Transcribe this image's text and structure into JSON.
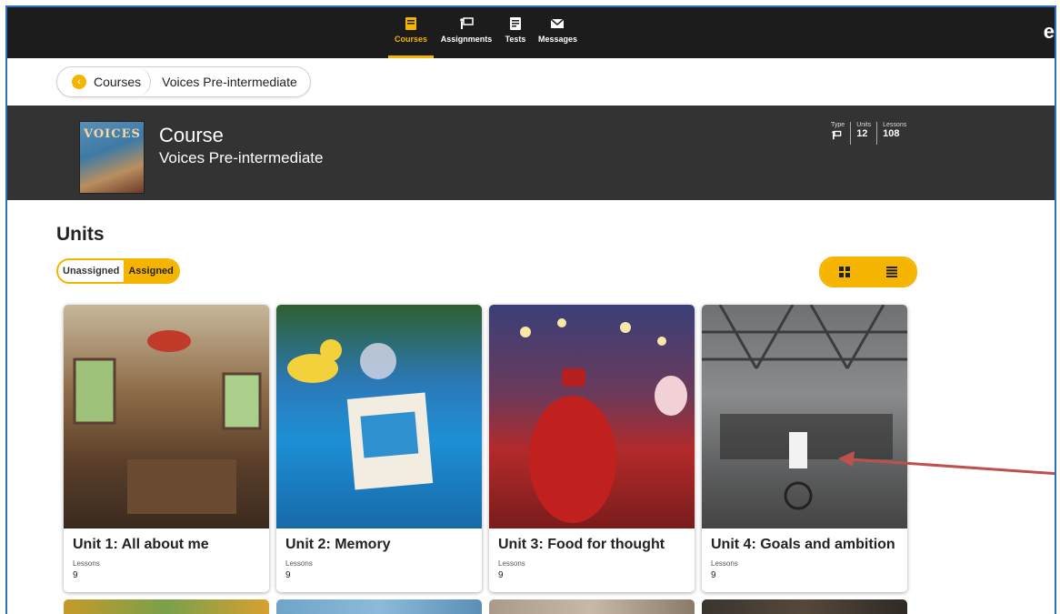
{
  "nav": {
    "items": [
      {
        "label": "Courses",
        "icon": "book-icon",
        "active": true
      },
      {
        "label": "Assignments",
        "icon": "assignment-icon",
        "active": false
      },
      {
        "label": "Tests",
        "icon": "test-icon",
        "active": false
      },
      {
        "label": "Messages",
        "icon": "envelope-icon",
        "active": false
      }
    ],
    "avatar_letter": "e"
  },
  "breadcrumb": {
    "back_label": "Courses",
    "current": "Voices Pre-intermediate"
  },
  "course": {
    "kind": "Course",
    "name": "Voices Pre-intermediate",
    "cover_text": "VOICES",
    "stats": {
      "type_label": "Type",
      "units_label": "Units",
      "units_value": "12",
      "lessons_label": "Lessons",
      "lessons_value": "108"
    }
  },
  "units": {
    "heading": "Units",
    "filter": {
      "unassigned": "Unassigned",
      "assigned": "Assigned",
      "selected": "Assigned"
    },
    "view_mode": "grid",
    "cards": [
      {
        "title": "Unit 1: All about me",
        "lessons_label": "Lessons",
        "lessons": "9"
      },
      {
        "title": "Unit 2: Memory",
        "lessons_label": "Lessons",
        "lessons": "9"
      },
      {
        "title": "Unit 3: Food for thought",
        "lessons_label": "Lessons",
        "lessons": "9"
      },
      {
        "title": "Unit 4: Goals and ambition",
        "lessons_label": "Lessons",
        "lessons": "9"
      }
    ]
  },
  "colors": {
    "accent": "#f5b400",
    "nav_bg": "#1c1c1c",
    "banner_bg": "#333333",
    "annotation_arrow": "#c0504d"
  }
}
